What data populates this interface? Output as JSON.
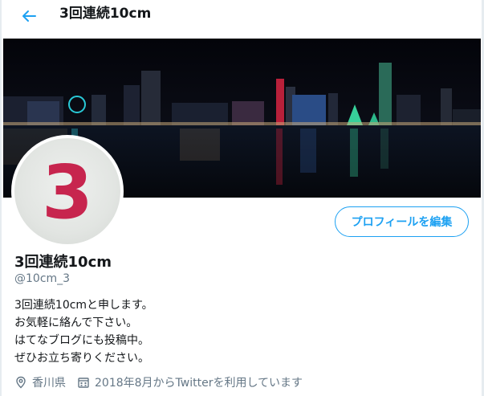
{
  "header": {
    "title": "3回連続10cm",
    "back_icon": "back-arrow-icon"
  },
  "profile": {
    "avatar_text": "3",
    "edit_button_label": "プロフィールを編集",
    "display_name": "3回連続10cm",
    "handle": "@10cm_3",
    "bio_lines": [
      "3回連続10cmと申します。",
      "お気軽に絡んで下さい。",
      "はてなブログにも投稿中。",
      "ぜひお立ち寄りください。"
    ],
    "location": "香川県",
    "joined": "2018年8月からTwitterを利用しています"
  },
  "colors": {
    "accent": "#1da1f2",
    "secondary_text": "#657786",
    "avatar_digit": "#c7254e"
  }
}
